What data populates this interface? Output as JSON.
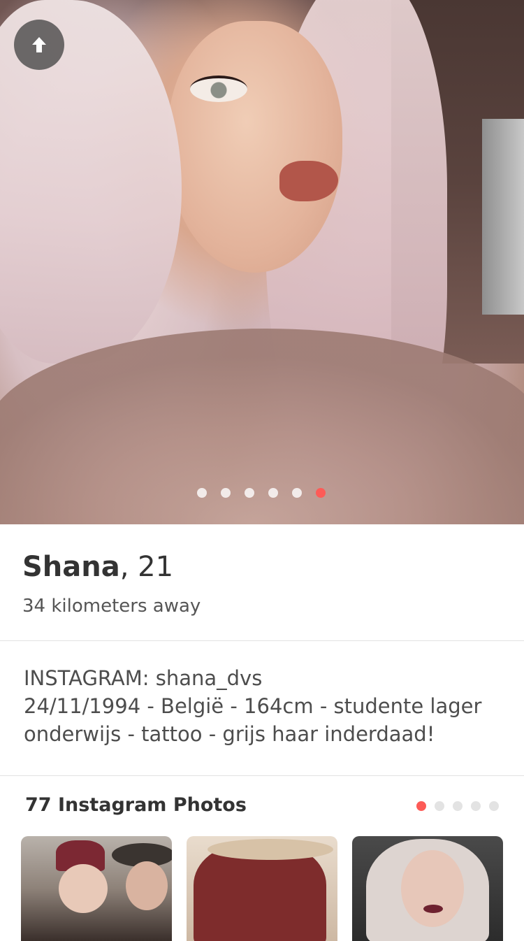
{
  "profile": {
    "name": "Shana",
    "age_text": ", 21",
    "distance": "34 kilometers away",
    "photo_count": 6,
    "active_photo_index": 5
  },
  "bio": {
    "lines": [
      " INSTAGRAM: shana_dvs",
      "24/11/1994 - België - 164cm - studente lager",
      "onderwijs - tattoo - grijs haar inderdaad!"
    ]
  },
  "instagram": {
    "header": "77 Instagram Photos",
    "page_count": 5,
    "active_page_index": 0
  },
  "icons": {
    "back": "arrow-up-icon"
  },
  "colors": {
    "accent": "#fd5b57",
    "text": "#333333",
    "divider": "#e2e2e2"
  }
}
